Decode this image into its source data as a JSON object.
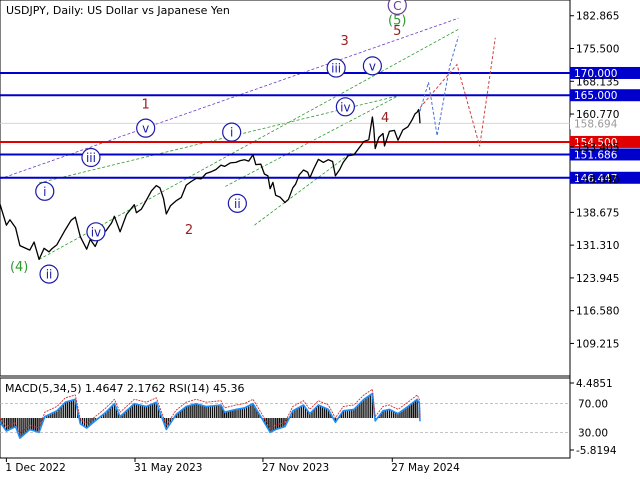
{
  "chart_data": [
    {
      "type": "line",
      "title": "USDJPY, Daily:  US Dollar vs Japanese Yen",
      "x_range": [
        "2022-11-22",
        "2024-07-05"
      ],
      "x_ticks": [
        {
          "date": "2022-12-01",
          "label": "1 Dec 2022"
        },
        {
          "date": "2023-05-31",
          "label": "31 May 2023"
        },
        {
          "date": "2023-11-27",
          "label": "27 Nov 2023"
        },
        {
          "date": "2024-05-27",
          "label": "27 May 2024"
        }
      ],
      "ylim": [
        101.9,
        186.4
      ],
      "y_tick_labels": [
        "182.865",
        "175.500",
        "168.135",
        "160.770",
        "153.405",
        "146.040",
        "138.675",
        "131.310",
        "123.945",
        "116.580",
        "109.215"
      ],
      "y_ticks": [
        182.865,
        175.5,
        168.135,
        160.77,
        153.405,
        146.04,
        138.675,
        131.31,
        123.945,
        116.58,
        109.215
      ],
      "current_price": {
        "value": 158.694,
        "label": "158.694"
      },
      "levels": [
        {
          "value": 170.0,
          "label": "170.000",
          "color": "#0000cc"
        },
        {
          "value": 165.0,
          "label": "165.000",
          "color": "#0000cc"
        },
        {
          "value": 154.5,
          "label": "154.500",
          "color": "#e00000"
        },
        {
          "value": 151.686,
          "label": "151.686",
          "color": "#0000cc"
        },
        {
          "value": 146.447,
          "label": "146.447",
          "color": "#0000cc"
        }
      ],
      "price_path": [
        [
          "2022-11-22",
          140.5
        ],
        [
          "2022-12-01",
          135.8
        ],
        [
          "2022-12-06",
          137.0
        ],
        [
          "2022-12-14",
          135.2
        ],
        [
          "2022-12-20",
          131.2
        ],
        [
          "2023-01-03",
          130.2
        ],
        [
          "2023-01-09",
          132.0
        ],
        [
          "2023-01-16",
          128.1
        ],
        [
          "2023-01-23",
          130.6
        ],
        [
          "2023-01-30",
          129.8
        ],
        [
          "2023-02-03",
          130.5
        ],
        [
          "2023-02-10",
          131.4
        ],
        [
          "2023-02-22",
          134.8
        ],
        [
          "2023-03-02",
          136.9
        ],
        [
          "2023-03-08",
          137.6
        ],
        [
          "2023-03-15",
          133.2
        ],
        [
          "2023-03-24",
          130.4
        ],
        [
          "2023-03-29",
          132.6
        ],
        [
          "2023-04-05",
          131.0
        ],
        [
          "2023-04-12",
          133.6
        ],
        [
          "2023-04-20",
          134.5
        ],
        [
          "2023-04-28",
          136.3
        ],
        [
          "2023-05-02",
          137.8
        ],
        [
          "2023-05-10",
          134.3
        ],
        [
          "2023-05-19",
          138.2
        ],
        [
          "2023-05-30",
          140.4
        ],
        [
          "2023-06-02",
          138.6
        ],
        [
          "2023-06-09",
          139.4
        ],
        [
          "2023-06-16",
          141.4
        ],
        [
          "2023-06-23",
          143.5
        ],
        [
          "2023-06-30",
          144.7
        ],
        [
          "2023-07-05",
          144.2
        ],
        [
          "2023-07-10",
          141.8
        ],
        [
          "2023-07-14",
          138.3
        ],
        [
          "2023-07-20",
          140.2
        ],
        [
          "2023-07-28",
          141.3
        ],
        [
          "2023-08-04",
          142.0
        ],
        [
          "2023-08-11",
          144.8
        ],
        [
          "2023-08-18",
          145.6
        ],
        [
          "2023-08-25",
          146.3
        ],
        [
          "2023-09-01",
          146.2
        ],
        [
          "2023-09-08",
          147.4
        ],
        [
          "2023-09-15",
          147.8
        ],
        [
          "2023-09-22",
          148.3
        ],
        [
          "2023-09-29",
          149.3
        ],
        [
          "2023-10-04",
          149.0
        ],
        [
          "2023-10-12",
          149.8
        ],
        [
          "2023-10-20",
          149.9
        ],
        [
          "2023-10-26",
          150.3
        ],
        [
          "2023-11-01",
          150.5
        ],
        [
          "2023-11-07",
          150.2
        ],
        [
          "2023-11-13",
          151.6
        ],
        [
          "2023-11-17",
          149.4
        ],
        [
          "2023-11-24",
          149.5
        ],
        [
          "2023-11-29",
          147.3
        ],
        [
          "2023-12-04",
          146.9
        ],
        [
          "2023-12-07",
          144.0
        ],
        [
          "2023-12-11",
          145.4
        ],
        [
          "2023-12-15",
          142.5
        ],
        [
          "2023-12-21",
          142.1
        ],
        [
          "2023-12-28",
          140.9
        ],
        [
          "2024-01-02",
          141.6
        ],
        [
          "2024-01-08",
          144.2
        ],
        [
          "2024-01-12",
          145.0
        ],
        [
          "2024-01-17",
          147.1
        ],
        [
          "2024-01-23",
          148.2
        ],
        [
          "2024-01-29",
          147.7
        ],
        [
          "2024-02-01",
          146.4
        ],
        [
          "2024-02-06",
          148.3
        ],
        [
          "2024-02-13",
          150.6
        ],
        [
          "2024-02-20",
          149.9
        ],
        [
          "2024-02-27",
          150.5
        ],
        [
          "2024-03-04",
          150.1
        ],
        [
          "2024-03-08",
          146.9
        ],
        [
          "2024-03-14",
          148.3
        ],
        [
          "2024-03-19",
          149.9
        ],
        [
          "2024-03-26",
          151.4
        ],
        [
          "2024-04-03",
          151.6
        ],
        [
          "2024-04-10",
          153.1
        ],
        [
          "2024-04-17",
          154.6
        ],
        [
          "2024-04-24",
          155.0
        ],
        [
          "2024-04-29",
          160.1
        ],
        [
          "2024-05-01",
          157.5
        ],
        [
          "2024-05-03",
          153.0
        ],
        [
          "2024-05-08",
          155.5
        ],
        [
          "2024-05-14",
          156.4
        ],
        [
          "2024-05-16",
          153.6
        ],
        [
          "2024-05-23",
          156.9
        ],
        [
          "2024-05-30",
          157.1
        ],
        [
          "2024-06-04",
          154.9
        ],
        [
          "2024-06-11",
          157.2
        ],
        [
          "2024-06-18",
          157.9
        ],
        [
          "2024-06-24",
          159.5
        ],
        [
          "2024-06-28",
          160.8
        ],
        [
          "2024-07-01",
          161.2
        ],
        [
          "2024-07-03",
          161.8
        ],
        [
          "2024-07-04",
          160.9
        ],
        [
          "2024-07-05",
          158.7
        ]
      ],
      "channel_lines": [
        {
          "color": "#6a3cc8",
          "points": [
            [
              "2022-11-22",
              146.2
            ],
            [
              "2024-08-28",
              182.3
            ]
          ]
        },
        {
          "color": "#2d9a2d",
          "points": [
            [
              "2023-01-16",
              128.1
            ],
            [
              "2024-08-28",
              179.8
            ]
          ]
        },
        {
          "color": "#2d9a2d",
          "points": [
            [
              "2023-01-16",
              145.3
            ],
            [
              "2024-06-05",
              164.9
            ]
          ]
        },
        {
          "color": "#2d9a2d",
          "points": [
            [
              "2023-10-05",
              144.5
            ],
            [
              "2024-06-05",
              164.9
            ]
          ]
        },
        {
          "color": "#2d9a2d",
          "points": [
            [
              "2023-11-15",
              135.8
            ],
            [
              "2024-03-30",
              152.0
            ]
          ]
        }
      ],
      "forecast_paths": [
        {
          "color": "#4a70d8",
          "points": [
            [
              "2024-07-05",
              161.4
            ],
            [
              "2024-07-17",
              167.9
            ],
            [
              "2024-07-29",
              155.9
            ],
            [
              "2024-08-16",
              171.6
            ],
            [
              "2024-08-28",
              178.2
            ]
          ]
        },
        {
          "color": "#d04040",
          "points": [
            [
              "2024-07-05",
              162.2
            ],
            [
              "2024-08-26",
              171.9
            ],
            [
              "2024-09-27",
              153.5
            ],
            [
              "2024-10-19",
              177.9
            ]
          ]
        }
      ],
      "wave_labels": [
        {
          "text": "(4)",
          "date": "2022-12-19",
          "value": 126.5,
          "color": "#2d9a2d",
          "circled": false
        },
        {
          "text": "i",
          "date": "2023-01-24",
          "value": 143.4,
          "color": "#1a1aa8",
          "circled": true
        },
        {
          "text": "ii",
          "date": "2023-01-30",
          "value": 124.8,
          "color": "#1a1aa8",
          "circled": true
        },
        {
          "text": "iii",
          "date": "2023-03-30",
          "value": 151.0,
          "color": "#1a1aa8",
          "circled": true
        },
        {
          "text": "iv",
          "date": "2023-04-06",
          "value": 134.3,
          "color": "#1a1aa8",
          "circled": true
        },
        {
          "text": "1",
          "date": "2023-06-15",
          "value": 163.0,
          "color": "#9a2020",
          "circled": false
        },
        {
          "text": "v",
          "date": "2023-06-15",
          "value": 157.6,
          "color": "#1a1aa8",
          "circled": true
        },
        {
          "text": "2",
          "date": "2023-08-15",
          "value": 134.8,
          "color": "#9a2020",
          "circled": false
        },
        {
          "text": "i",
          "date": "2023-10-14",
          "value": 156.7,
          "color": "#1a1aa8",
          "circled": true
        },
        {
          "text": "ii",
          "date": "2023-10-22",
          "value": 140.7,
          "color": "#1a1aa8",
          "circled": true
        },
        {
          "text": "iii",
          "date": "2024-03-09",
          "value": 171.1,
          "color": "#1a1aa8",
          "circled": true
        },
        {
          "text": "iv",
          "date": "2024-03-22",
          "value": 162.4,
          "color": "#1a1aa8",
          "circled": true
        },
        {
          "text": "v",
          "date": "2024-04-29",
          "value": 171.6,
          "color": "#1a1aa8",
          "circled": true
        },
        {
          "text": "3",
          "date": "2024-03-21",
          "value": 177.3,
          "color": "#9a2020",
          "circled": false
        },
        {
          "text": "4",
          "date": "2024-05-17",
          "value": 160.0,
          "color": "#9a2020",
          "circled": false
        },
        {
          "text": "5",
          "date": "2024-06-03",
          "value": 179.6,
          "color": "#9a2020",
          "circled": false
        },
        {
          "text": "(5)",
          "date": "2024-06-03",
          "value": 181.9,
          "color": "#2d9a2d",
          "circled": false
        },
        {
          "text": "C",
          "date": "2024-06-03",
          "value": 185.2,
          "color": "#6a3c98",
          "circled": true
        }
      ]
    },
    {
      "type": "line",
      "title": "MACD(5,34,5)  1.4647  2.1762  RSI(14)  45.36",
      "indicators": [
        {
          "name": "MACD(5,34,5)",
          "values": [
            1.4647,
            2.1762
          ]
        },
        {
          "name": "RSI(14)",
          "value": 45.36
        }
      ],
      "macd_axis": {
        "max_label": "4.4851",
        "max": 4.4851,
        "min_label": "-5.8194",
        "min": -5.8194
      },
      "rsi_axis": {
        "levels": [
          70.0,
          30.0
        ],
        "level_labels": [
          "70.00",
          "30.00"
        ]
      },
      "rsi_path": [
        [
          "2022-11-22",
          44
        ],
        [
          "2022-12-01",
          32
        ],
        [
          "2022-12-14",
          38
        ],
        [
          "2022-12-20",
          22
        ],
        [
          "2023-01-03",
          34
        ],
        [
          "2023-01-16",
          30
        ],
        [
          "2023-01-24",
          52
        ],
        [
          "2023-02-10",
          60
        ],
        [
          "2023-02-22",
          72
        ],
        [
          "2023-03-08",
          76
        ],
        [
          "2023-03-15",
          42
        ],
        [
          "2023-03-24",
          36
        ],
        [
          "2023-04-05",
          46
        ],
        [
          "2023-04-20",
          58
        ],
        [
          "2023-05-02",
          70
        ],
        [
          "2023-05-10",
          52
        ],
        [
          "2023-05-30",
          70
        ],
        [
          "2023-06-16",
          66
        ],
        [
          "2023-06-30",
          72
        ],
        [
          "2023-07-14",
          34
        ],
        [
          "2023-07-28",
          55
        ],
        [
          "2023-08-11",
          66
        ],
        [
          "2023-08-25",
          70
        ],
        [
          "2023-09-08",
          66
        ],
        [
          "2023-09-29",
          68
        ],
        [
          "2023-10-04",
          58
        ],
        [
          "2023-10-20",
          62
        ],
        [
          "2023-11-01",
          64
        ],
        [
          "2023-11-13",
          70
        ],
        [
          "2023-11-24",
          52
        ],
        [
          "2023-12-07",
          30
        ],
        [
          "2023-12-15",
          34
        ],
        [
          "2023-12-28",
          38
        ],
        [
          "2024-01-08",
          60
        ],
        [
          "2024-01-23",
          68
        ],
        [
          "2024-02-01",
          56
        ],
        [
          "2024-02-13",
          68
        ],
        [
          "2024-02-27",
          62
        ],
        [
          "2024-03-08",
          44
        ],
        [
          "2024-03-19",
          60
        ],
        [
          "2024-04-03",
          62
        ],
        [
          "2024-04-17",
          76
        ],
        [
          "2024-04-29",
          84
        ],
        [
          "2024-05-03",
          46
        ],
        [
          "2024-05-14",
          60
        ],
        [
          "2024-05-23",
          62
        ],
        [
          "2024-06-04",
          56
        ],
        [
          "2024-06-18",
          66
        ],
        [
          "2024-07-01",
          76
        ],
        [
          "2024-07-04",
          70
        ],
        [
          "2024-07-05",
          45.36
        ]
      ]
    }
  ]
}
